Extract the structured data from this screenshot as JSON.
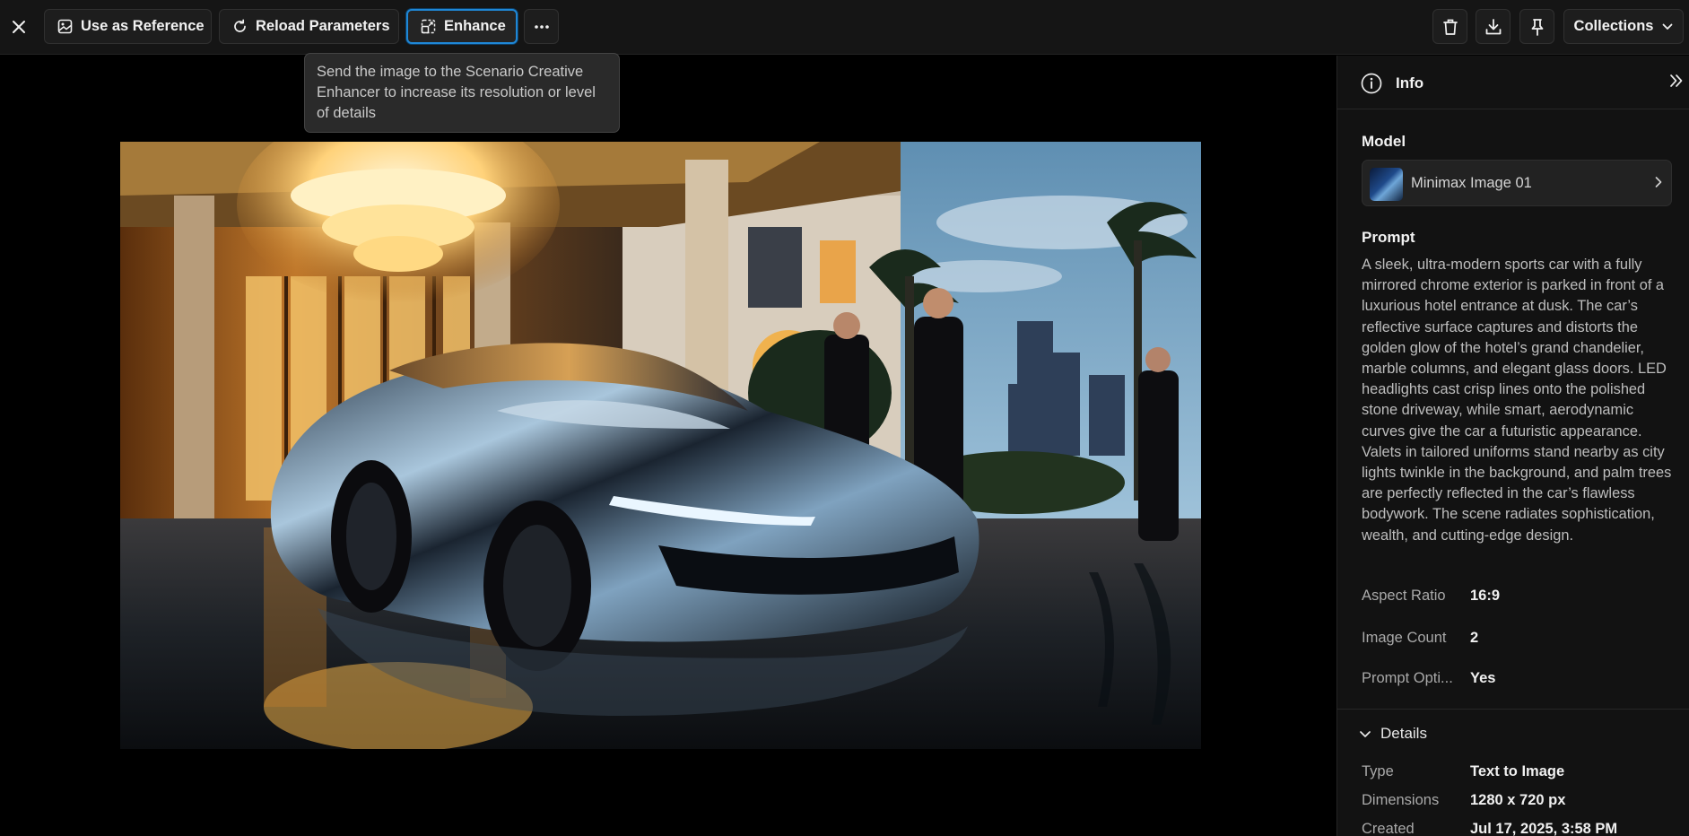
{
  "toolbar": {
    "use_as_reference": "Use as Reference",
    "reload_parameters": "Reload Parameters",
    "enhance": "Enhance",
    "collections": "Collections"
  },
  "tooltip": {
    "text": "Send the image to the Scenario Creative Enhancer to increase its resolution or level of details"
  },
  "panel": {
    "title": "Info",
    "model_label": "Model",
    "model_name": "Minimax Image 01",
    "prompt_label": "Prompt",
    "prompt": "A sleek, ultra-modern sports car with a fully mirrored chrome exterior is parked in front of a luxurious hotel entrance at dusk. The car’s reflective surface captures and distorts the golden glow of the hotel’s grand chandelier, marble columns, and elegant glass doors. LED headlights cast crisp lines onto the polished stone driveway, while smart, aerodynamic curves give the car a futuristic appearance. Valets in tailored uniforms stand nearby as city lights twinkle in the background, and palm trees are perfectly reflected in the car’s flawless bodywork. The scene radiates sophistication, wealth, and cutting-edge design.",
    "params": [
      {
        "key": "Aspect Ratio",
        "value": "16:9"
      },
      {
        "key": "Image Count",
        "value": "2"
      },
      {
        "key": "Prompt Opti...",
        "value": "Yes"
      }
    ],
    "details_label": "Details",
    "details": [
      {
        "key": "Type",
        "value": "Text to Image"
      },
      {
        "key": "Dimensions",
        "value": "1280 x 720 px"
      },
      {
        "key": "Created",
        "value": "Jul 17, 2025, 3:58 PM"
      }
    ]
  },
  "colors": {
    "accent": "#1f87d6",
    "background": "#000000",
    "panel": "#121212"
  },
  "icons": [
    "close-icon",
    "image-icon",
    "reload-icon",
    "enhance-icon",
    "more-icon",
    "trash-icon",
    "download-icon",
    "pin-icon",
    "chevron-down-icon",
    "info-icon",
    "double-chevron-right-icon",
    "chevron-right-icon",
    "grid-view-icon"
  ]
}
